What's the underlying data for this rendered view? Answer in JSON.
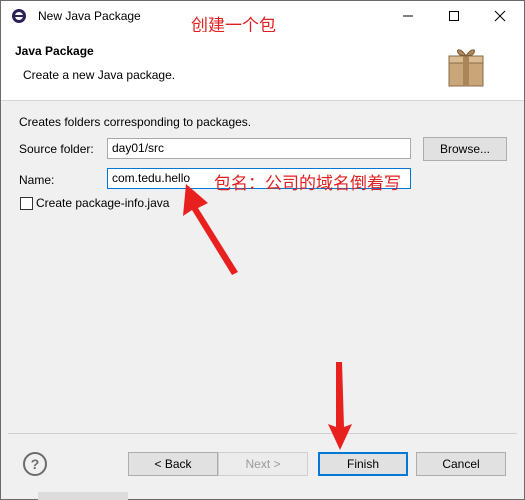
{
  "window": {
    "title": "New Java Package",
    "controls": {
      "minimize": "minimize",
      "maximize": "maximize",
      "close": "close"
    }
  },
  "annotations": {
    "title_note": "创建一个包",
    "name_note": "包名：公司的域名倒着写",
    "color": "#e02020"
  },
  "header": {
    "title": "Java Package",
    "subtitle": "Create a new Java package.",
    "icon": "package-icon"
  },
  "form": {
    "description": "Creates folders corresponding to packages.",
    "source_folder_label": "Source folder:",
    "source_folder_value": "day01/src",
    "browse_label": "Browse...",
    "name_label": "Name:",
    "name_value": "com.tedu.hello",
    "create_info_label": "Create package-info.java",
    "create_info_checked": false
  },
  "footer": {
    "help_icon": "?",
    "back_label": "< Back",
    "next_label": "Next >",
    "finish_label": "Finish",
    "cancel_label": "Cancel"
  },
  "colors": {
    "accent": "#0078d7",
    "annotation": "#e02020"
  }
}
